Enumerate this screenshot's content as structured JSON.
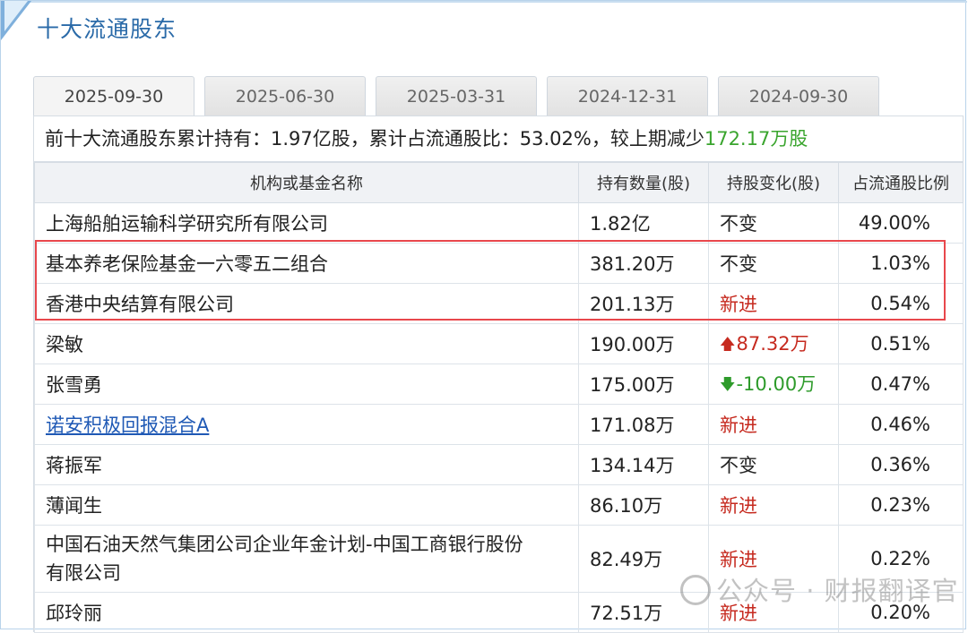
{
  "panel": {
    "title": "十大流通股东"
  },
  "tabs": [
    {
      "label": "2025-09-30",
      "active": true
    },
    {
      "label": "2025-06-30",
      "active": false
    },
    {
      "label": "2025-03-31",
      "active": false
    },
    {
      "label": "2024-12-31",
      "active": false
    },
    {
      "label": "2024-09-30",
      "active": false
    }
  ],
  "summary": {
    "prefix": "前十大流通股东累计持有：",
    "total": "1.97亿股",
    "mid": "，累计占流通股比：",
    "ratio": "53.02%",
    "sep": "，较上期减少",
    "change": "172.17万股"
  },
  "table": {
    "headers": [
      "机构或基金名称",
      "持有数量(股)",
      "持股变化(股)",
      "占流通股比例"
    ],
    "rows": [
      {
        "name": "上海船舶运输科学研究所有限公司",
        "qty": "1.82亿",
        "change": "不变",
        "pct": "49.00%"
      },
      {
        "name": "基本养老保险基金一六零五二组合",
        "qty": "381.20万",
        "change": "不变",
        "pct": "1.03%"
      },
      {
        "name": "香港中央结算有限公司",
        "qty": "201.13万",
        "change": "新进",
        "pct": "0.54%"
      },
      {
        "name": "梁敏",
        "qty": "190.00万",
        "change": "87.32万",
        "pct": "0.51%"
      },
      {
        "name": "张雪勇",
        "qty": "175.00万",
        "change": "-10.00万",
        "pct": "0.47%"
      },
      {
        "name": "诺安积极回报混合A",
        "qty": "171.08万",
        "change": "新进",
        "pct": "0.46%"
      },
      {
        "name": "蒋振军",
        "qty": "134.14万",
        "change": "不变",
        "pct": "0.36%"
      },
      {
        "name": "薄闻生",
        "qty": "86.10万",
        "change": "新进",
        "pct": "0.23%"
      },
      {
        "name_line1": "中国石油天然气集团公司企业年金计划-中国工商银行股份",
        "name_line2": "有限公司",
        "qty": "82.49万",
        "change": "新进",
        "pct": "0.22%"
      },
      {
        "name": "邱玲丽",
        "qty": "72.51万",
        "change": "新进",
        "pct": "0.20%"
      }
    ]
  },
  "icons": {
    "up": "arrow-up-icon",
    "down": "arrow-down-icon"
  },
  "colors": {
    "title": "#2a6aa8",
    "increase": "#c62a1f",
    "decrease": "#2e9b2b",
    "summary_change": "#3aa52e",
    "highlight": "#e8474c"
  },
  "watermark": {
    "text": "公众号 · 财报翻译官"
  }
}
